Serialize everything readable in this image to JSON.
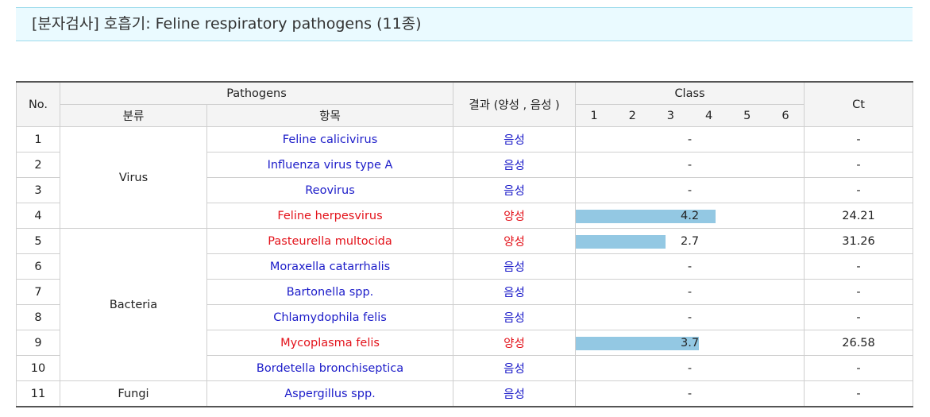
{
  "title": "[분자검사]  호흡기: Feline respiratory pathogens (11종)",
  "headers": {
    "no": "No.",
    "pathogens": "Pathogens",
    "category": "분류",
    "item": "항목",
    "result": "결과 (양성 , 음성 )",
    "class": "Class",
    "class_ticks": [
      "1",
      "2",
      "3",
      "4",
      "5",
      "6"
    ],
    "ct": "Ct"
  },
  "class_max": 6,
  "categories": [
    {
      "name": "Virus",
      "rows": 4
    },
    {
      "name": "Bacteria",
      "rows": 6
    },
    {
      "name": "Fungi",
      "rows": 1
    }
  ],
  "rows": [
    {
      "no": "1",
      "item": "Feline calicivirus",
      "result": "음성",
      "positive": false,
      "class": null,
      "class_text": "-",
      "ct": "-"
    },
    {
      "no": "2",
      "item": "Influenza virus type A",
      "result": "음성",
      "positive": false,
      "class": null,
      "class_text": "-",
      "ct": "-"
    },
    {
      "no": "3",
      "item": "Reovirus",
      "result": "음성",
      "positive": false,
      "class": null,
      "class_text": "-",
      "ct": "-"
    },
    {
      "no": "4",
      "item": "Feline herpesvirus",
      "result": "양성",
      "positive": true,
      "class": 4.2,
      "class_text": "4.2",
      "ct": "24.21"
    },
    {
      "no": "5",
      "item": "Pasteurella multocida",
      "result": "양성",
      "positive": true,
      "class": 2.7,
      "class_text": "2.7",
      "ct": "31.26"
    },
    {
      "no": "6",
      "item": "Moraxella catarrhalis",
      "result": "음성",
      "positive": false,
      "class": null,
      "class_text": "-",
      "ct": "-"
    },
    {
      "no": "7",
      "item": "Bartonella spp.",
      "result": "음성",
      "positive": false,
      "class": null,
      "class_text": "-",
      "ct": "-"
    },
    {
      "no": "8",
      "item": "Chlamydophila felis",
      "result": "음성",
      "positive": false,
      "class": null,
      "class_text": "-",
      "ct": "-"
    },
    {
      "no": "9",
      "item": "Mycoplasma felis",
      "result": "양성",
      "positive": true,
      "class": 3.7,
      "class_text": "3.7",
      "ct": "26.58"
    },
    {
      "no": "10",
      "item": "Bordetella bronchiseptica",
      "result": "음성",
      "positive": false,
      "class": null,
      "class_text": "-",
      "ct": "-"
    },
    {
      "no": "11",
      "item": "Aspergillus spp.",
      "result": "음성",
      "positive": false,
      "class": null,
      "class_text": "-",
      "ct": "-"
    }
  ],
  "colors": {
    "negative": "#1c1cc9",
    "positive": "#e3121a",
    "bar": "#93c8e3",
    "title_bg": "#eafaff",
    "title_border": "#9fdcec"
  }
}
